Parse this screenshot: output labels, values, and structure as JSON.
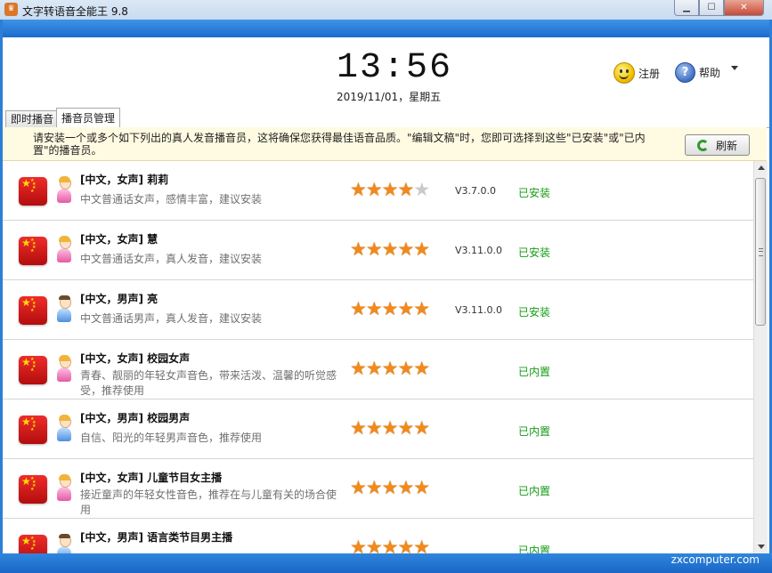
{
  "window": {
    "title": "文字转语音全能王 9.8",
    "app_icon": "crown-icon",
    "controls": [
      "minimize-icon",
      "maximize-icon",
      "close-icon"
    ]
  },
  "header": {
    "time": "13:56",
    "date": "2019/11/01，星期五",
    "register_label": "注册",
    "help_label": "帮助"
  },
  "tabs": [
    {
      "label": "即时播音",
      "active": false
    },
    {
      "label": "播音员管理",
      "active": true
    }
  ],
  "notice": {
    "text": "请安装一个或多个如下列出的真人发音播音员，这将确保您获得最佳语音品质。\"编辑文稿\"时，您即可选择到这些\"已安装\"或\"已内置\"的播音员。",
    "refresh_label": "刷新"
  },
  "speakers": [
    {
      "name": "[中文，女声] 莉莉",
      "desc": "中文普通话女声，感情丰富，建议安装",
      "gender": "female",
      "rating": 4,
      "version": "V3.7.0.0",
      "status": "已安装"
    },
    {
      "name": "[中文，女声] 慧",
      "desc": "中文普通话女声，真人发音，建议安装",
      "gender": "female",
      "rating": 5,
      "version": "V3.11.0.0",
      "status": "已安装"
    },
    {
      "name": "[中文，男声] 亮",
      "desc": "中文普通话男声，真人发音，建议安装",
      "gender": "male",
      "rating": 5,
      "version": "V3.11.0.0",
      "status": "已安装"
    },
    {
      "name": "[中文，女声] 校园女声",
      "desc": "青春、靓丽的年轻女声音色，带来活泼、温馨的听觉感受，推荐使用",
      "gender": "female",
      "rating": 5,
      "version": "",
      "status": "已内置"
    },
    {
      "name": "[中文，男声] 校园男声",
      "desc": "自信、阳光的年轻男声音色，推荐使用",
      "gender": "male",
      "rating": 5,
      "version": "",
      "status": "已内置"
    },
    {
      "name": "[中文，女声] 儿童节目女主播",
      "desc": "接近童声的年轻女性音色，推荐在与儿童有关的场合使用",
      "gender": "female",
      "rating": 5,
      "version": "",
      "status": "已内置"
    },
    {
      "name": "[中文，男声] 语言类节目男主播",
      "desc": "",
      "gender": "male",
      "rating": 5,
      "version": "",
      "status": "已内置"
    }
  ],
  "watermark": "zxcomputer.com",
  "colors": {
    "status_green": "#159b15",
    "star_orange": "#f08a1c",
    "frame_blue": "#2c7fd6"
  }
}
